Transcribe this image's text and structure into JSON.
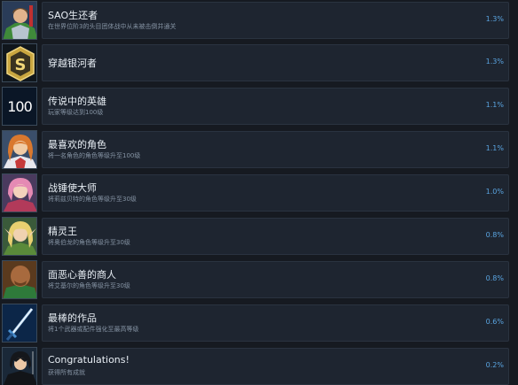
{
  "achievements": [
    {
      "title": "SAO生还者",
      "desc": "在世界位阶3的头目团体战中从未被击倒并通关",
      "pct": "1.3%",
      "icon": "armored-knight-portrait-icon"
    },
    {
      "title": "穿越银河者",
      "desc": "",
      "pct": "1.3%",
      "icon": "gold-s-emblem-icon"
    },
    {
      "title": "传说中的英雄",
      "desc": "玩家等级达到100级",
      "pct": "1.1%",
      "icon": "level-100-icon",
      "icon_text": "100"
    },
    {
      "title": "最喜欢的角色",
      "desc": "将一名角色的角色等级升至100级",
      "pct": "1.1%",
      "icon": "orange-haired-girl-portrait-icon"
    },
    {
      "title": "战锤使大师",
      "desc": "将莉兹贝特的角色等级升至30级",
      "pct": "1.0%",
      "icon": "pink-haired-girl-portrait-icon"
    },
    {
      "title": "精灵王",
      "desc": "将奥伯龙的角色等级升至30级",
      "pct": "0.8%",
      "icon": "blonde-elf-portrait-icon"
    },
    {
      "title": "面恶心善的商人",
      "desc": "将艾基尔的角色等级升至30级",
      "pct": "0.8%",
      "icon": "bald-merchant-portrait-icon"
    },
    {
      "title": "最棒的作品",
      "desc": "将1个武器或配件强化至最高等级",
      "pct": "0.6%",
      "icon": "sword-icon"
    },
    {
      "title": "Congratulations!",
      "desc": "获得所有成就",
      "pct": "0.2%",
      "icon": "black-swordsman-portrait-icon"
    }
  ]
}
